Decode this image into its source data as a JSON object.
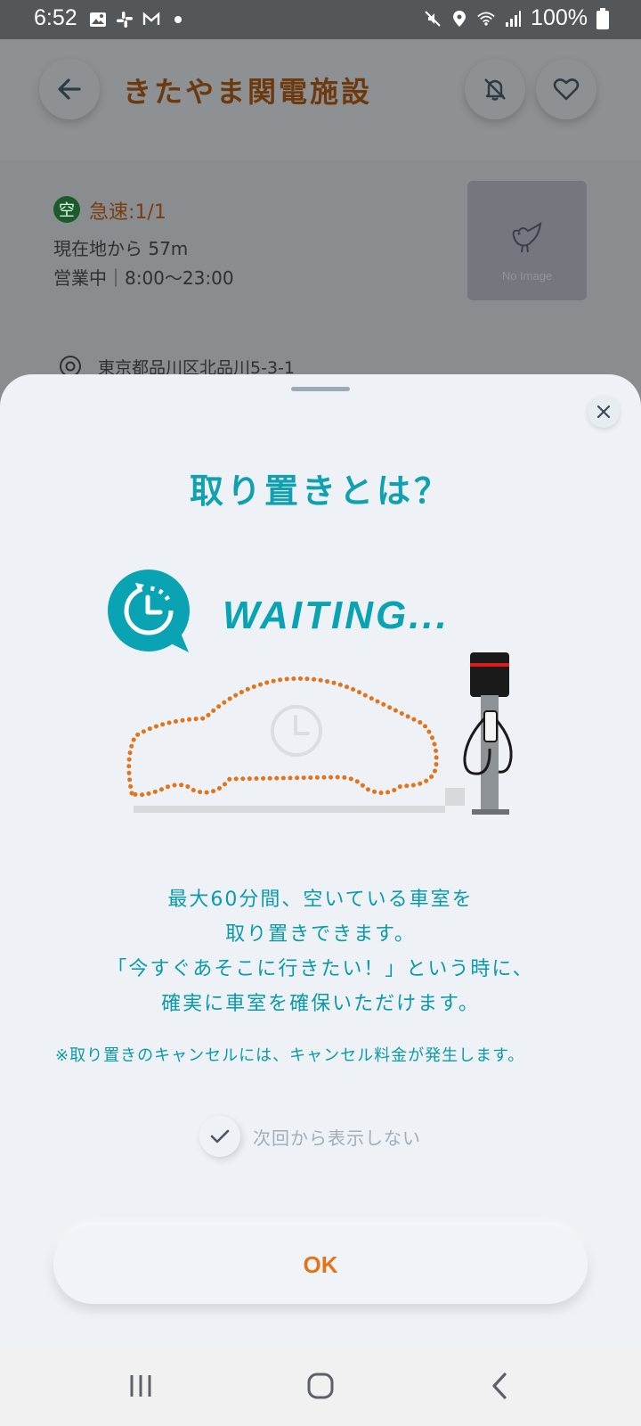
{
  "status_bar": {
    "time": "6:52",
    "battery": "100%",
    "left_icons": [
      "gallery-icon",
      "slack-icon",
      "gmail-icon",
      "dot-icon"
    ],
    "right_icons": [
      "mute-icon",
      "location-icon",
      "wifi-icon",
      "signal-icon",
      "battery-icon"
    ]
  },
  "header": {
    "title": "きたやま関電施設"
  },
  "facility": {
    "availability_badge": "空",
    "availability_text": "急速:1/1",
    "distance": "現在地から 57m",
    "hours": "営業中｜8:00～23:00",
    "no_image_label": "No Image",
    "address": "東京都品川区北品川5-3-1"
  },
  "sheet": {
    "title": "取り置きとは？",
    "waiting_label": "WAITING...",
    "description_lines": [
      "最大60分間、空いている車室を",
      "取り置きできます。",
      "「今すぐあそこに行きたい！」という時に、",
      "確実に車室を確保いただけます。"
    ],
    "note": "※取り置きのキャンセルには、キャンセル料金が発生します。",
    "dont_show_label": "次回から表示しない",
    "ok_label": "OK"
  },
  "colors": {
    "accent_teal": "#0fa0b2",
    "accent_orange": "#e2741c",
    "sheet_bg": "#eef2f6"
  }
}
